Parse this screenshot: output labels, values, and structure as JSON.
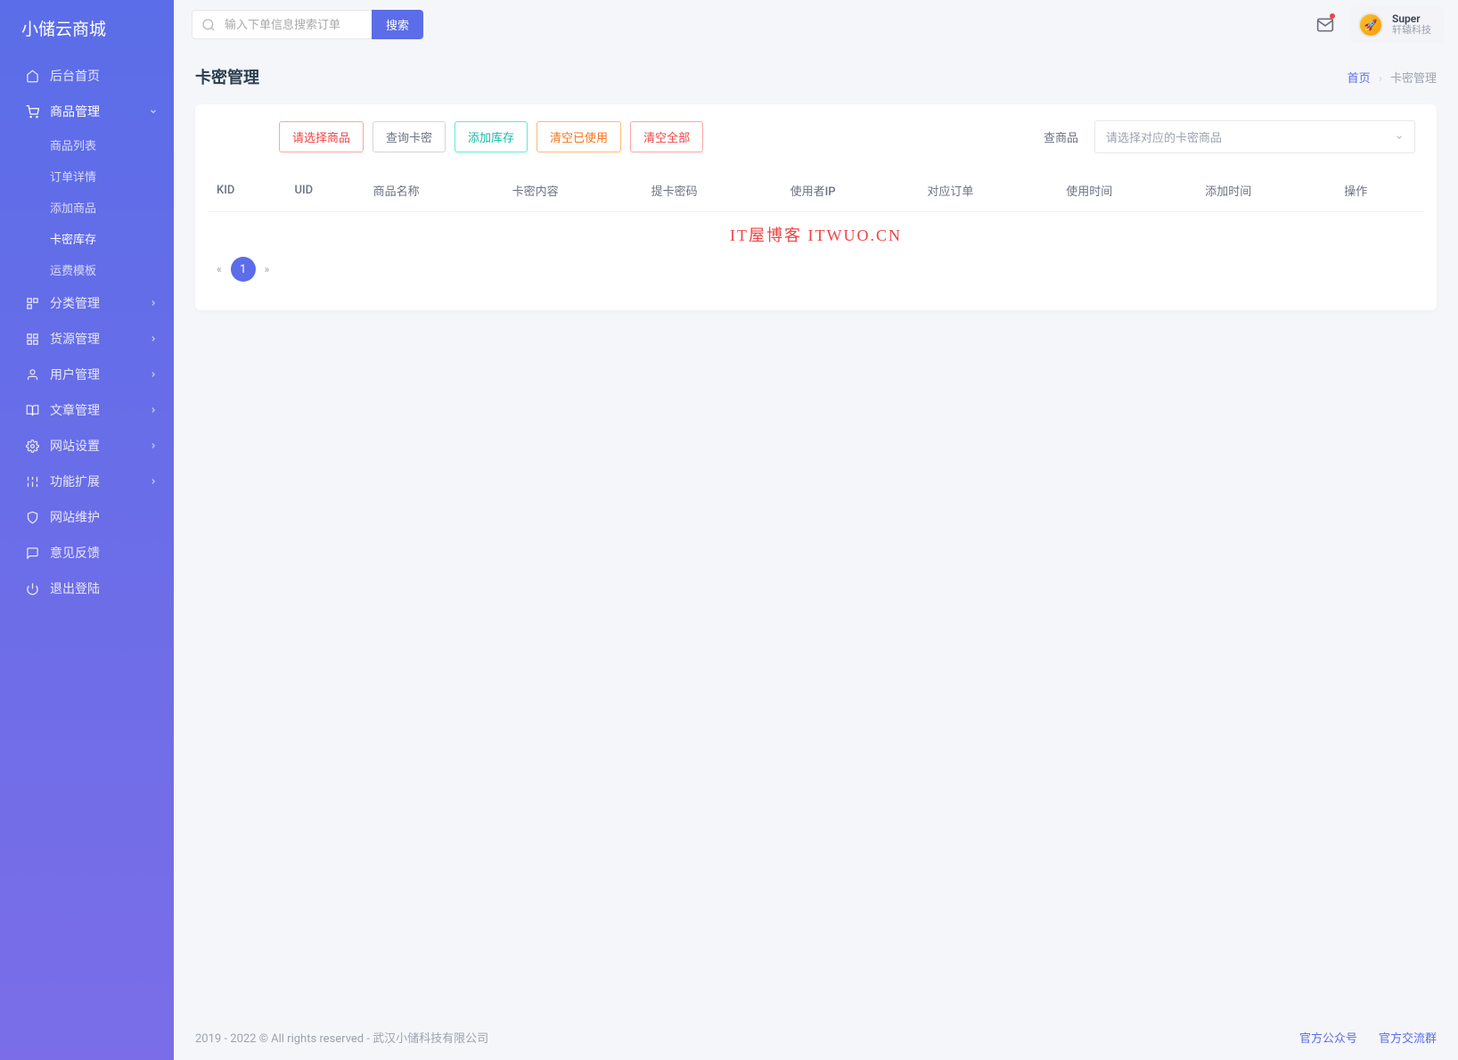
{
  "brand": "小储云商城",
  "sidebar": {
    "home": "后台首页",
    "product_mgmt": "商品管理",
    "sub": {
      "product_list": "商品列表",
      "order_detail": "订单详情",
      "add_product": "添加商品",
      "card_stock": "卡密库存",
      "shipping_template": "运费模板"
    },
    "category_mgmt": "分类管理",
    "supply_mgmt": "货源管理",
    "user_mgmt": "用户管理",
    "article_mgmt": "文章管理",
    "site_settings": "网站设置",
    "feature_ext": "功能扩展",
    "site_maint": "网站维护",
    "feedback": "意见反馈",
    "logout": "退出登陆"
  },
  "header": {
    "search_placeholder": "输入下单信息搜索订单",
    "search_btn": "搜索",
    "user_name": "Super",
    "user_sub": "轩辕科技"
  },
  "page": {
    "title": "卡密管理",
    "breadcrumb_home": "首页",
    "breadcrumb_current": "卡密管理"
  },
  "toolbar": {
    "select_product": "请选择商品",
    "query_card": "查询卡密",
    "add_stock": "添加库存",
    "clear_used": "清空已使用",
    "clear_all": "清空全部",
    "query_label": "查商品",
    "select_placeholder": "请选择对应的卡密商品"
  },
  "table": {
    "kid": "KID",
    "uid": "UID",
    "product_name": "商品名称",
    "card_content": "卡密内容",
    "pickup_pwd": "提卡密码",
    "user_ip": "使用者IP",
    "order": "对应订单",
    "use_time": "使用时间",
    "add_time": "添加时间",
    "action": "操作"
  },
  "watermark": "IT屋博客  ITWUO.CN",
  "pagination": {
    "current": "1"
  },
  "footer": {
    "copyright": "2019 - 2022 © All rights reserved - 武汉小储科技有限公司",
    "link_official": "官方公众号",
    "link_group": "官方交流群"
  }
}
